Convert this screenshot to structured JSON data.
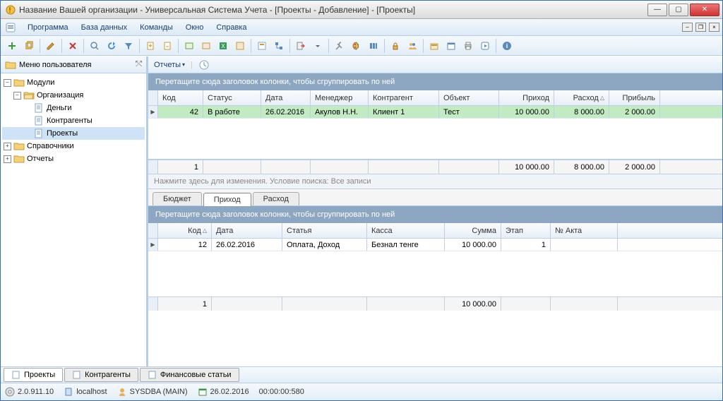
{
  "window": {
    "title": "Название Вашей организации - Универсальная Система Учета - [Проекты - Добавление] - [Проекты]"
  },
  "menu": [
    "Программа",
    "База данных",
    "Команды",
    "Окно",
    "Справка"
  ],
  "left_panel": {
    "title": "Меню пользователя"
  },
  "tree": {
    "modules": "Модули",
    "org": "Организация",
    "money": "Деньги",
    "contragents": "Контрагенты",
    "projects": "Проекты",
    "refs": "Справочники",
    "reports": "Отчеты"
  },
  "reports_bar": {
    "label": "Отчеты"
  },
  "group_hint": "Перетащите сюда заголовок колонки, чтобы сгруппировать по ней",
  "main_grid": {
    "headers": [
      "Код",
      "Статус",
      "Дата",
      "Менеджер",
      "Контрагент",
      "Объект",
      "Приход",
      "Расход",
      "Прибыль"
    ],
    "rows": [
      {
        "code": "42",
        "status": "В работе",
        "date": "26.02.2016",
        "manager": "Акулов Н.Н.",
        "contragent": "Клиент 1",
        "object": "Тест",
        "income": "10 000.00",
        "expense": "8 000.00",
        "profit": "2 000.00"
      }
    ],
    "footer": {
      "count": "1",
      "income": "10 000.00",
      "expense": "8 000.00",
      "profit": "2 000.00"
    }
  },
  "filter_hint": "Нажмите здесь для изменения. Условие поиска: Все записи",
  "sub_tabs": [
    "Бюджет",
    "Приход",
    "Расход"
  ],
  "sub_grid": {
    "headers": [
      "Код",
      "Дата",
      "Статья",
      "Касса",
      "Сумма",
      "Этап",
      "№ Акта"
    ],
    "rows": [
      {
        "code": "12",
        "date": "26.02.2016",
        "article": "Оплата, Доход",
        "kassa": "Безнал тенге",
        "sum": "10 000.00",
        "stage": "1",
        "act": ""
      }
    ],
    "footer": {
      "count": "1",
      "sum": "10 000.00"
    }
  },
  "bottom_tabs": [
    "Проекты",
    "Контрагенты",
    "Финансовые статьи"
  ],
  "status": {
    "version": "2.0.911.10",
    "host": "localhost",
    "user": "SYSDBA (MAIN)",
    "date": "26.02.2016",
    "time": "00:00:00:580"
  }
}
